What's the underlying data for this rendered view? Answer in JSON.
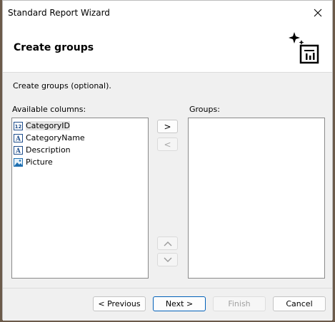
{
  "window": {
    "title": "Standard Report Wizard"
  },
  "header": {
    "title": "Create groups",
    "icon": "wizard-report-sparkle-icon"
  },
  "instruction": "Create groups (optional).",
  "available": {
    "label": "Available columns:",
    "items": [
      {
        "label": "CategoryID",
        "icon": "numeric-field-icon"
      },
      {
        "label": "CategoryName",
        "icon": "text-field-icon"
      },
      {
        "label": "Description",
        "icon": "text-field-icon"
      },
      {
        "label": "Picture",
        "icon": "image-field-icon"
      }
    ]
  },
  "groups": {
    "label": "Groups:",
    "items": []
  },
  "buttons": {
    "add": ">",
    "remove": "<",
    "move_up": "chevron-up-icon",
    "move_down": "chevron-down-icon",
    "previous": "< Previous",
    "next": "Next >",
    "finish": "Finish",
    "cancel": "Cancel"
  },
  "colors": {
    "accent": "#005fb8",
    "body_bg": "#f0f0f0"
  }
}
